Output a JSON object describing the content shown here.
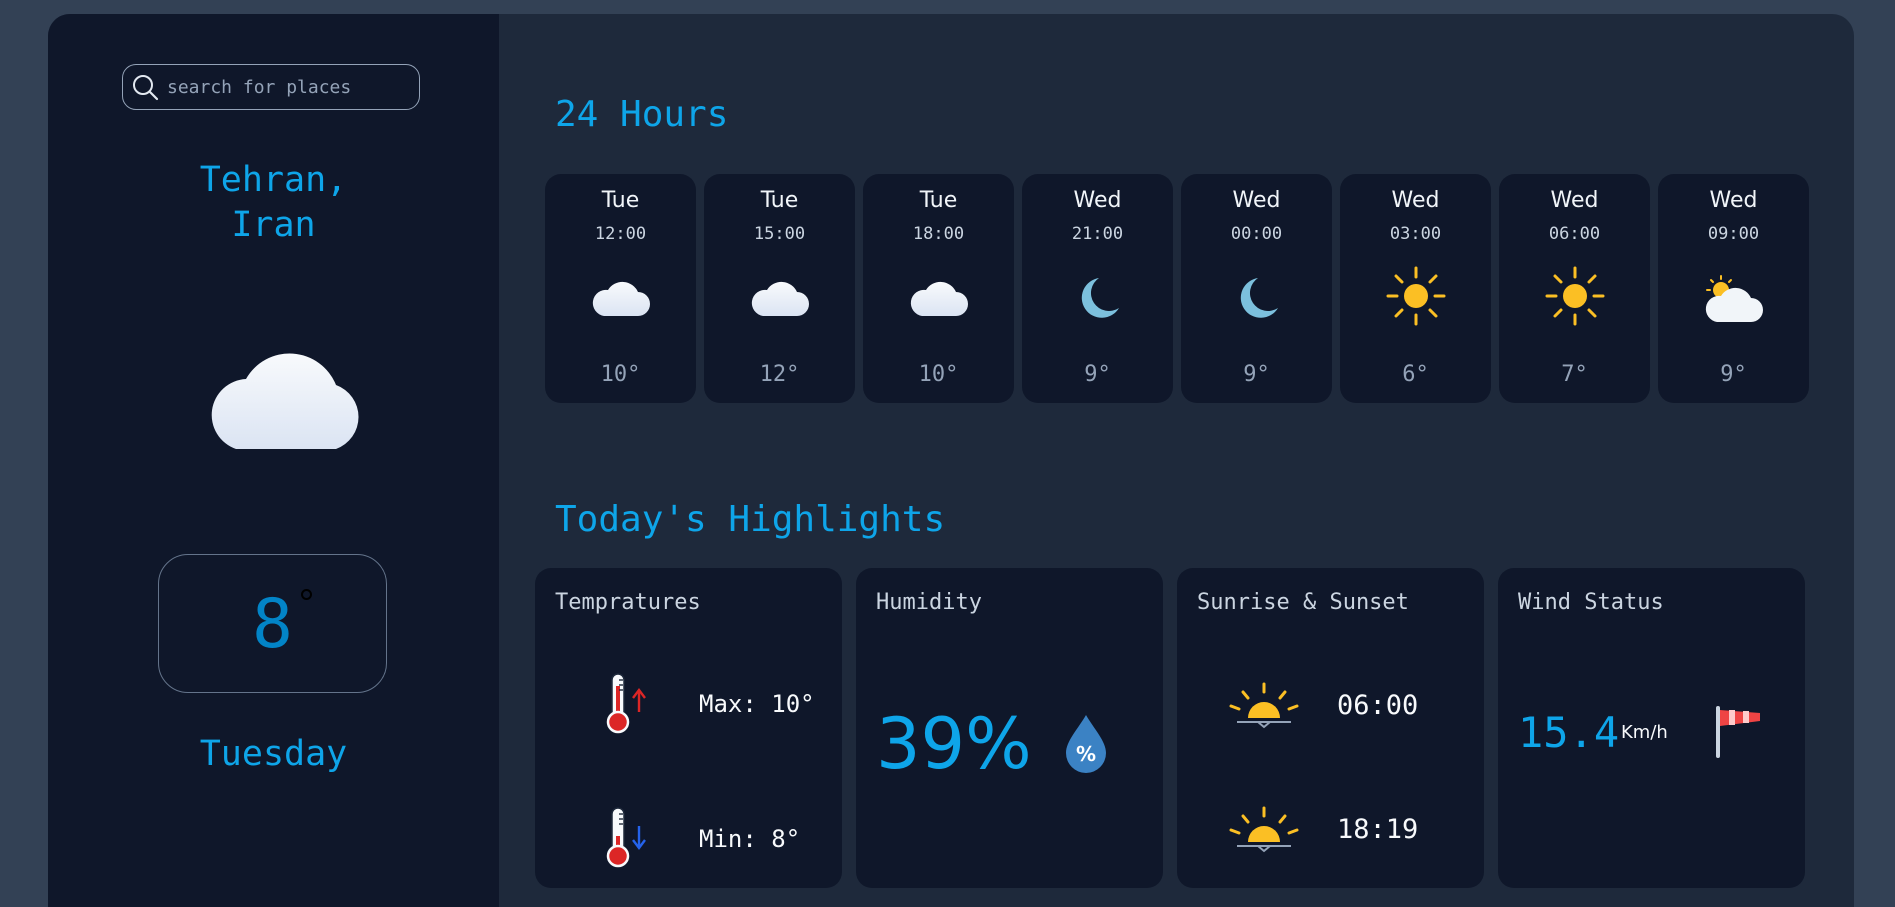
{
  "search": {
    "placeholder": "search for places",
    "value": ""
  },
  "location": {
    "city_line1": "Tehran,",
    "city_line2": "Iran"
  },
  "current": {
    "icon": "cloud-icon",
    "temperature": "8",
    "day": "Tuesday"
  },
  "theme_toggle": {
    "icon": "sun-icon"
  },
  "hourly": {
    "title": "24 Hours",
    "items": [
      {
        "day": "Tue",
        "time": "12:00",
        "icon": "cloud-icon",
        "temp": "10°"
      },
      {
        "day": "Tue",
        "time": "15:00",
        "icon": "cloud-icon",
        "temp": "12°"
      },
      {
        "day": "Tue",
        "time": "18:00",
        "icon": "cloud-icon",
        "temp": "10°"
      },
      {
        "day": "Wed",
        "time": "21:00",
        "icon": "moon-icon",
        "temp": "9°"
      },
      {
        "day": "Wed",
        "time": "00:00",
        "icon": "moon-icon",
        "temp": "9°"
      },
      {
        "day": "Wed",
        "time": "03:00",
        "icon": "sun-icon",
        "temp": "6°"
      },
      {
        "day": "Wed",
        "time": "06:00",
        "icon": "sun-icon",
        "temp": "7°"
      },
      {
        "day": "Wed",
        "time": "09:00",
        "icon": "sun-cloud-icon",
        "temp": "9°"
      }
    ]
  },
  "highlights": {
    "title": "Today's Highlights",
    "temperatures": {
      "title": "Tempratures",
      "max": "Max: 10°",
      "min": "Min: 8°"
    },
    "humidity": {
      "title": "Humidity",
      "value": "39%"
    },
    "sun": {
      "title": "Sunrise & Sunset",
      "sunrise": "06:00",
      "sunset": "18:19"
    },
    "wind": {
      "title": "Wind Status",
      "value": "15.4",
      "unit": "Km/h"
    }
  }
}
